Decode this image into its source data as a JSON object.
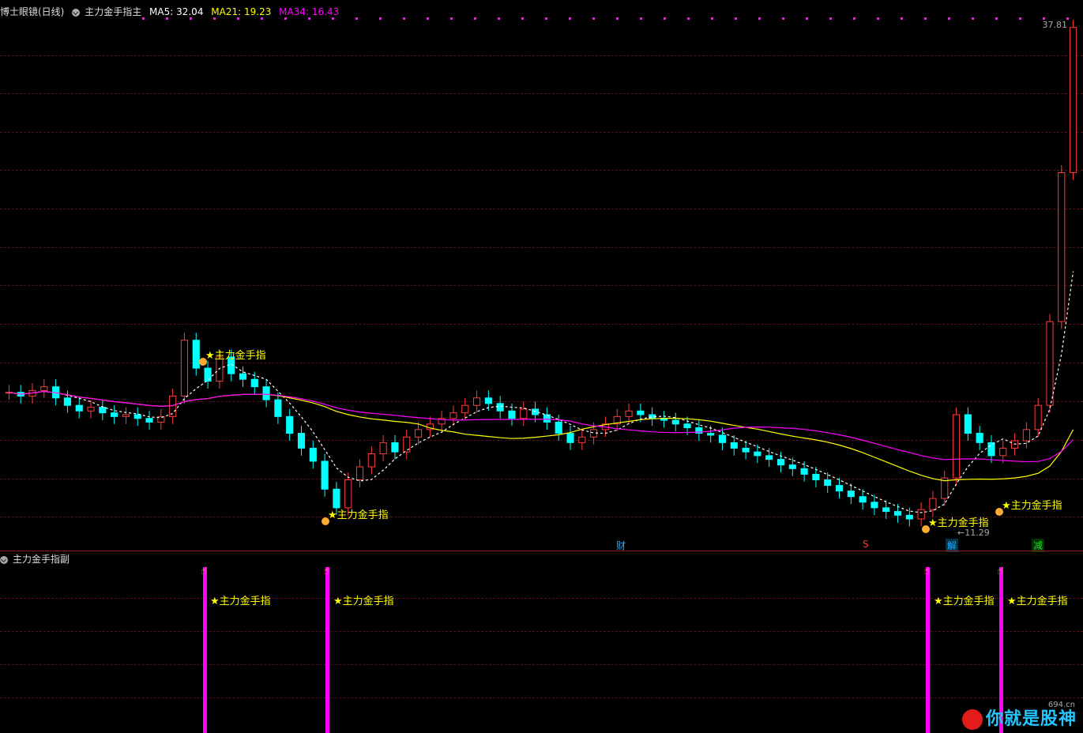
{
  "header": {
    "indicator_name": "博士眼镜(日线)",
    "main_indicator": "主力金手指主",
    "ma5_label": "MA5: 32.04",
    "ma21_label": "MA21: 19.23",
    "ma34_label": "MA34: 16.43"
  },
  "price_axis": {
    "top_value": "37.81",
    "low_value": "11.29"
  },
  "sub_panel": {
    "title": "主力金手指副"
  },
  "signal_label": "主力金手指",
  "events": {
    "cai": "财",
    "s": "S",
    "jie": "解",
    "jian": "减"
  },
  "colors": {
    "up": "#ff3b3b",
    "down": "#00ffff",
    "ma5": "#ffffff",
    "ma21": "#ffff00",
    "ma34": "#ff00ff",
    "signal": "#ff00ff"
  },
  "chart_data": {
    "type": "candlestick",
    "ma_lines": [
      "MA5",
      "MA21",
      "MA34"
    ],
    "ylim": [
      10,
      38
    ],
    "closes": [
      18.2,
      18.0,
      18.3,
      18.5,
      17.9,
      17.5,
      17.2,
      17.4,
      17.1,
      16.9,
      17.0,
      16.8,
      16.6,
      16.9,
      18.0,
      21.0,
      19.5,
      18.8,
      20.1,
      19.2,
      18.9,
      18.5,
      17.8,
      16.9,
      16.0,
      15.2,
      14.5,
      13.0,
      12.0,
      13.5,
      14.2,
      14.9,
      15.5,
      15.0,
      15.8,
      16.2,
      16.5,
      16.8,
      17.1,
      17.5,
      17.9,
      17.6,
      17.2,
      16.8,
      17.3,
      17.0,
      16.6,
      16.0,
      15.5,
      15.8,
      16.2,
      16.5,
      16.9,
      17.2,
      17.0,
      16.8,
      16.7,
      16.5,
      16.3,
      16.0,
      15.9,
      15.5,
      15.2,
      15.0,
      14.8,
      14.6,
      14.3,
      14.1,
      13.8,
      13.5,
      13.2,
      12.9,
      12.6,
      12.3,
      12.0,
      11.8,
      11.6,
      11.4,
      11.9,
      12.5,
      13.6,
      17.0,
      16.0,
      15.5,
      14.8,
      15.2,
      15.6,
      16.2,
      17.5,
      22.0,
      30.0,
      37.8
    ]
  }
}
